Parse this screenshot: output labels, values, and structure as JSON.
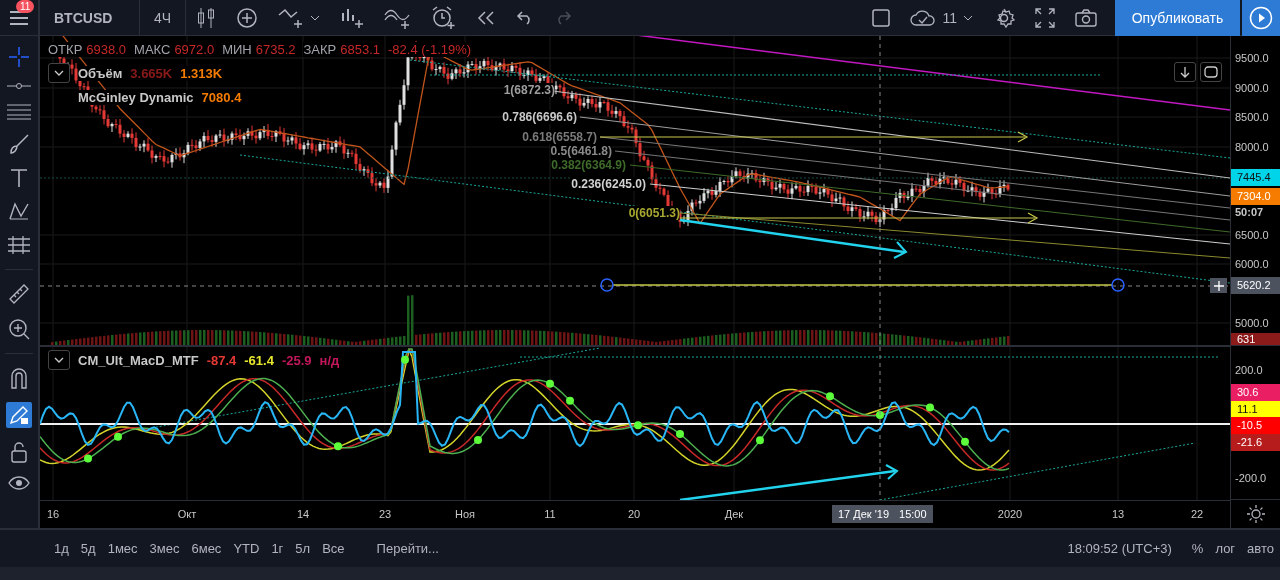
{
  "toolbar": {
    "notification_badge": "11",
    "symbol": "BTCUSD",
    "interval": "4Ч",
    "cloud_count": "11",
    "publish_button": "Опубликовать"
  },
  "legend": {
    "ohlc": [
      {
        "label": "ОТКР",
        "value": "6938.0"
      },
      {
        "label": "МАКС",
        "value": "6972.0"
      },
      {
        "label": "МИН",
        "value": "6735.2"
      },
      {
        "label": "ЗАКР",
        "value": "6853.1"
      }
    ],
    "change": "-82.4 (-1.19%)"
  },
  "indicators": [
    {
      "name": "Объём",
      "collapsible": true,
      "values": [
        {
          "text": "3.665K",
          "color": "#8b1a1a"
        },
        {
          "text": "1.313K",
          "color": "#f57c00"
        }
      ]
    },
    {
      "name": "McGinley Dynamic",
      "collapsible": false,
      "values": [
        {
          "text": "7080.4",
          "color": "#f57c00"
        }
      ]
    }
  ],
  "fib_levels": [
    {
      "label": "1(6872.3)",
      "color": "#9e9e9e"
    },
    {
      "label": "0.786(6696.6)",
      "color": "#c8c8c8"
    },
    {
      "label": "0.618(6558.7)",
      "color": "#7a7a7a"
    },
    {
      "label": "0.5(6461.8)",
      "color": "#8a8a8a"
    },
    {
      "label": "0.382(6364.9)",
      "color": "#3f6b2a"
    },
    {
      "label": "0.236(6245.0)",
      "color": "#d0d0d0"
    },
    {
      "label": "0(6051.3)",
      "color": "#a8a830"
    }
  ],
  "price_axis": {
    "ticks": [
      "9500.0",
      "9000.0",
      "8500.0",
      "8000.0",
      "6500.0",
      "6000.0",
      "5000.0"
    ],
    "markers": [
      {
        "text": "7445.4",
        "color": "#00d4e8"
      },
      {
        "text": "7304.0",
        "color": "#f57c00"
      }
    ],
    "countdown": "50:07",
    "crosshair_price": "5620.2",
    "volume_marker": {
      "text": "631",
      "color": "#8b1a1a"
    }
  },
  "macd": {
    "name": "CM_Ult_MacD_MTF",
    "values": [
      {
        "text": "-87.4",
        "color": "#e53935"
      },
      {
        "text": "-61.4",
        "color": "#e6e62e"
      },
      {
        "text": "-25.9",
        "color": "#c2185b"
      },
      {
        "text": "н/д",
        "color": "#c2185b"
      }
    ],
    "axis_ticks": [
      "200.0",
      "-200.0"
    ],
    "markers": [
      {
        "text": "30.6",
        "color": "#e91e63"
      },
      {
        "text": "11.1",
        "color": "#ffff00"
      },
      {
        "text": "-10.5",
        "color": "#ff0000"
      },
      {
        "text": "-21.6",
        "color": "#b71c1c"
      }
    ]
  },
  "time_axis": {
    "labels": [
      "16",
      "Окт",
      "14",
      "23",
      "Ноя",
      "11",
      "20",
      "Дек",
      "2020",
      "13",
      "22"
    ],
    "crosshair_date": "17 Дек '19",
    "crosshair_time": "15:00"
  },
  "ranges": [
    "1д",
    "5д",
    "1мес",
    "3мес",
    "6мес",
    "YTD",
    "1г",
    "5л",
    "Все"
  ],
  "goto": "Перейти...",
  "clock": "18:09:52 (UTC+3)",
  "scale_options": [
    "%",
    "лог",
    "авто"
  ]
}
